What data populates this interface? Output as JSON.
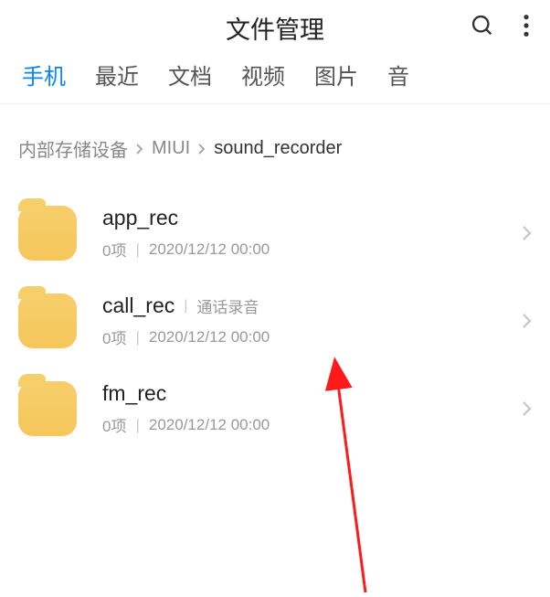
{
  "header": {
    "title": "文件管理"
  },
  "tabs": {
    "items": [
      {
        "label": "手机",
        "active": true
      },
      {
        "label": "最近",
        "active": false
      },
      {
        "label": "文档",
        "active": false
      },
      {
        "label": "视频",
        "active": false
      },
      {
        "label": "图片",
        "active": false
      },
      {
        "label": "音",
        "active": false
      }
    ]
  },
  "breadcrumb": {
    "items": [
      {
        "label": "内部存储设备",
        "current": false
      },
      {
        "label": "MIUI",
        "current": false
      },
      {
        "label": "sound_recorder",
        "current": true
      }
    ]
  },
  "folders": [
    {
      "name": "app_rec",
      "tag": "",
      "count": "0项",
      "time": "2020/12/12 00:00"
    },
    {
      "name": "call_rec",
      "tag": "通话录音",
      "count": "0项",
      "time": "2020/12/12 00:00"
    },
    {
      "name": "fm_rec",
      "tag": "",
      "count": "0项",
      "time": "2020/12/12 00:00"
    }
  ],
  "icons": {
    "search": "search-icon",
    "more": "more-icon",
    "chevron": "chevron-right-icon",
    "folder": "folder-icon"
  }
}
